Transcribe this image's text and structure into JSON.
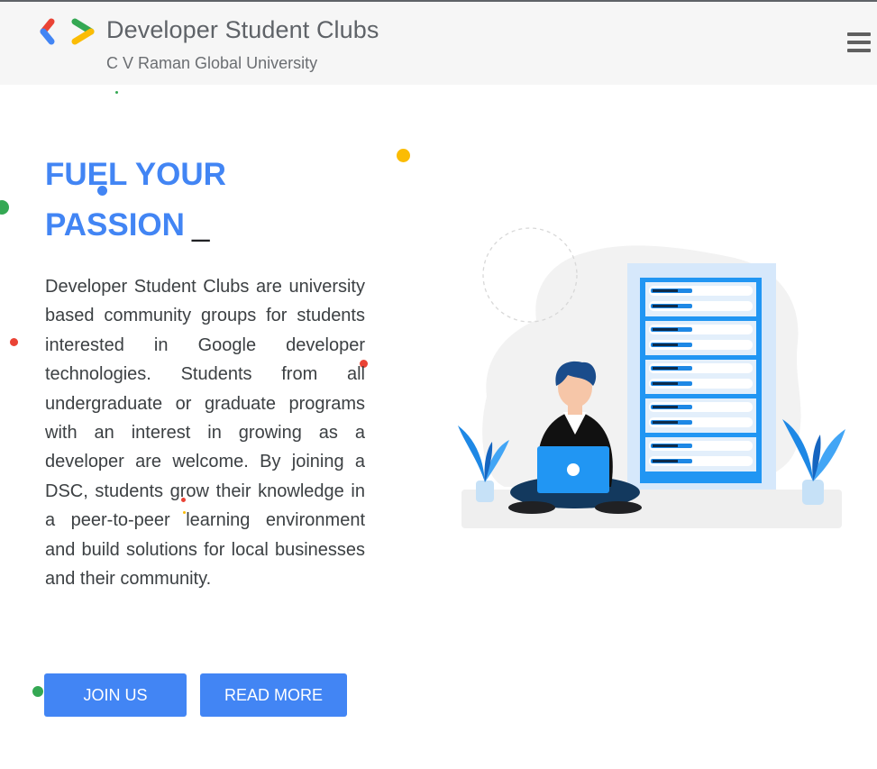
{
  "header": {
    "title": "Developer Student Clubs",
    "subtitle": "C V Raman Global University"
  },
  "hero": {
    "title_line1": "FUEL YOUR",
    "title_line2": "PASSION",
    "cursor": "_",
    "description": "Developer Student Clubs are university based community groups for students interested in Google developer technologies. Students from all undergraduate or graduate programs with an interest in growing as a developer are welcome. By joining a DSC, students grow their knowledge in a peer-to-peer learning environment and build solutions for local businesses and their community."
  },
  "buttons": {
    "join": "JOIN US",
    "read_more": "READ MORE"
  },
  "icons": {
    "logo": "dsc-logo-icon",
    "menu": "hamburger-menu-icon"
  },
  "colors": {
    "google_blue": "#4285f4",
    "google_red": "#ea4335",
    "google_yellow": "#fbbc04",
    "google_green": "#34a853"
  }
}
